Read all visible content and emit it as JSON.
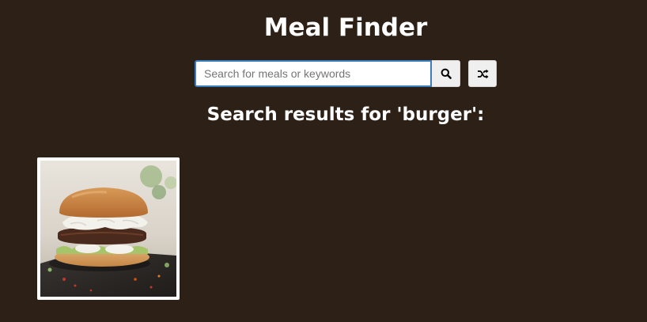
{
  "header": {
    "title": "Meal Finder"
  },
  "search": {
    "placeholder": "Search for meals or keywords",
    "value": "",
    "submit_icon": "search-icon",
    "random_icon": "shuffle-icon"
  },
  "results": {
    "heading": "Search results for 'burger':",
    "meals": [
      {
        "image": "burger-photo"
      }
    ]
  },
  "colors": {
    "background": "#2d2016",
    "text": "#ffffff",
    "input_border": "#3b7dbd",
    "button_bg": "#efefef"
  }
}
